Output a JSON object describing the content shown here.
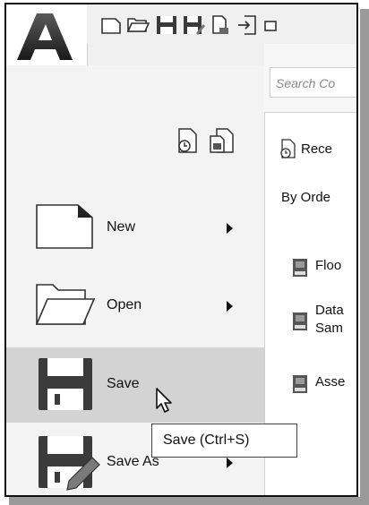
{
  "app": {
    "logo_letter": "A"
  },
  "quick_access": {
    "icons": [
      "new-icon",
      "open-icon",
      "save-icon",
      "save-as-icon",
      "open-from-web-icon",
      "export-icon",
      "print-icon"
    ]
  },
  "search": {
    "placeholder": "Search Co"
  },
  "left_menu": {
    "items": [
      {
        "label": "New",
        "icon": "new-document-icon",
        "has_submenu": true
      },
      {
        "label": "Open",
        "icon": "open-folder-icon",
        "has_submenu": true
      },
      {
        "label": "Save",
        "icon": "save-floppy-icon",
        "has_submenu": false,
        "active": true
      },
      {
        "label": "Save As",
        "icon": "save-as-floppy-pencil-icon",
        "has_submenu": true
      }
    ]
  },
  "right_panel": {
    "recent_label": "Rece",
    "order_label": "By Orde",
    "documents": [
      {
        "lines": [
          "Floo"
        ],
        "icon": "dwg-file-icon"
      },
      {
        "lines": [
          "Data",
          "Sam"
        ],
        "icon": "dwg-file-icon"
      },
      {
        "lines": [
          "Asse"
        ],
        "icon": "dwg-file-icon"
      }
    ]
  },
  "tooltip": {
    "text": "Save (Ctrl+S)"
  }
}
